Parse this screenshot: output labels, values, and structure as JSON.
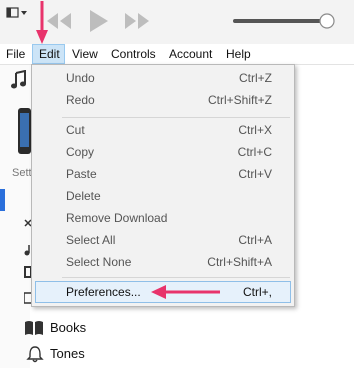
{
  "menubar": {
    "items": [
      {
        "label": "File"
      },
      {
        "label": "Edit"
      },
      {
        "label": "View"
      },
      {
        "label": "Controls"
      },
      {
        "label": "Account"
      },
      {
        "label": "Help"
      }
    ]
  },
  "sidebar": {
    "section_label": "Sett"
  },
  "edit_menu": {
    "items": [
      {
        "label": "Undo",
        "shortcut": "Ctrl+Z"
      },
      {
        "label": "Redo",
        "shortcut": "Ctrl+Shift+Z"
      },
      {
        "label": "Cut",
        "shortcut": "Ctrl+X"
      },
      {
        "label": "Copy",
        "shortcut": "Ctrl+C"
      },
      {
        "label": "Paste",
        "shortcut": "Ctrl+V"
      },
      {
        "label": "Delete",
        "shortcut": ""
      },
      {
        "label": "Remove Download",
        "shortcut": ""
      },
      {
        "label": "Select All",
        "shortcut": "Ctrl+A"
      },
      {
        "label": "Select None",
        "shortcut": "Ctrl+Shift+A"
      },
      {
        "label": "Preferences...",
        "shortcut": "Ctrl+,"
      }
    ]
  },
  "library": {
    "items": [
      {
        "label": "Books",
        "icon": "book-icon"
      },
      {
        "label": "Tones",
        "icon": "bell-icon"
      }
    ]
  },
  "colors": {
    "annotation_arrow": "#e8336b",
    "selection_blue": "#2a6fdb"
  }
}
